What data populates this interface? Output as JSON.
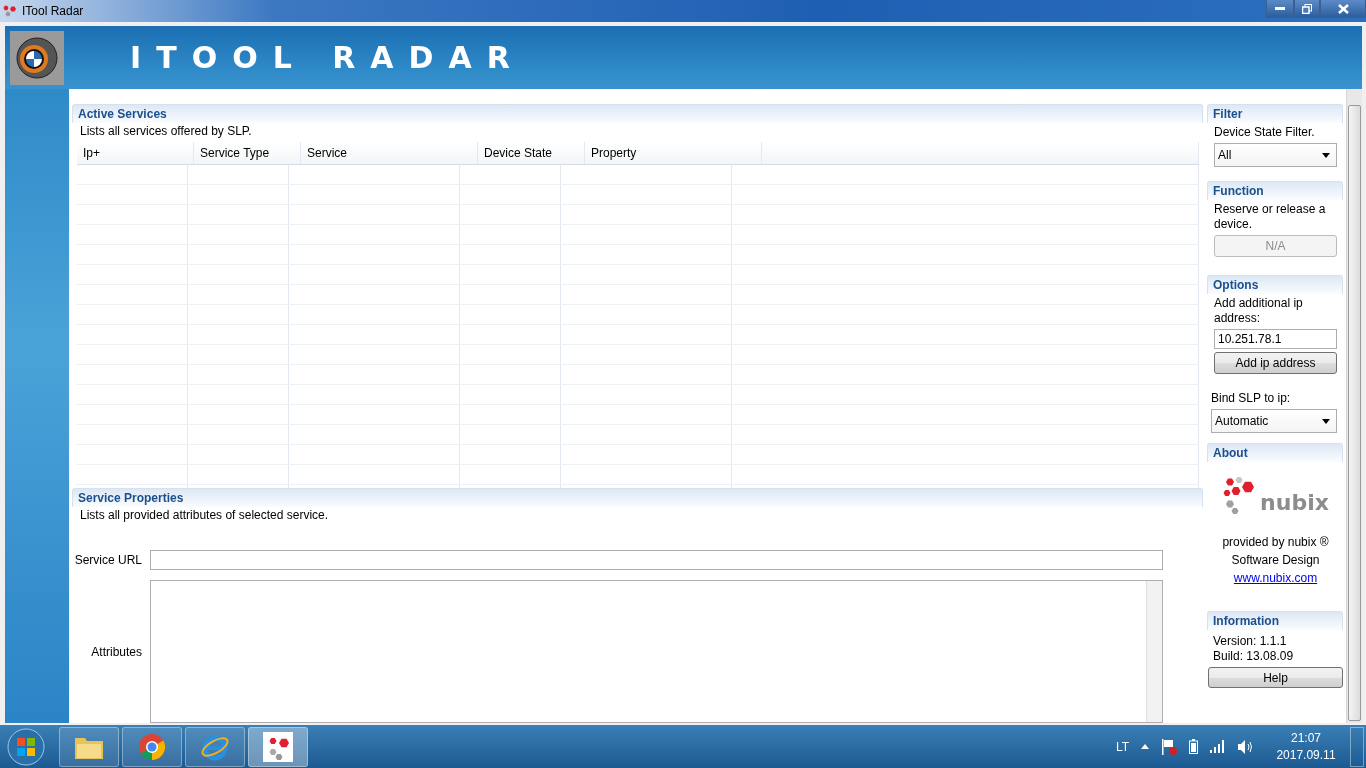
{
  "window": {
    "title": "ITool Radar"
  },
  "banner": {
    "title": "ITOOL RADAR"
  },
  "active_services": {
    "title": "Active Services",
    "description": "Lists all services offered by SLP.",
    "columns": [
      "Ip+",
      "Service Type",
      "Service",
      "Device State",
      "Property"
    ]
  },
  "service_properties": {
    "title": "Service Properties",
    "description": "Lists all provided attributes of selected service.",
    "fields": [
      {
        "label": "Service URL",
        "kind": "line"
      },
      {
        "label": "Attributes",
        "kind": "area"
      }
    ]
  },
  "filter": {
    "title": "Filter",
    "label": "Device State Filter.",
    "value": "All"
  },
  "function": {
    "title": "Function",
    "description": "Reserve or release  a device.",
    "button": {
      "label": "N/A",
      "disabled": true
    }
  },
  "options": {
    "title": "Options",
    "label": "Add additional ip address:",
    "ip_value": "10.251.78.1",
    "add_button": "Add ip address",
    "bind_label": "Bind SLP to ip:",
    "bind_value": "Automatic"
  },
  "about": {
    "title": "About",
    "logo_text": "nubix",
    "provided_by": "provided by nubix ®",
    "company": "Software Design",
    "link": "www.nubix.com"
  },
  "information": {
    "title": "Information",
    "version": "Version: 1.1.1",
    "build": "Build: 13.08.09",
    "help_button": "Help"
  },
  "tray": {
    "language": "LT",
    "time": "21:07",
    "date": "2017.09.11"
  }
}
